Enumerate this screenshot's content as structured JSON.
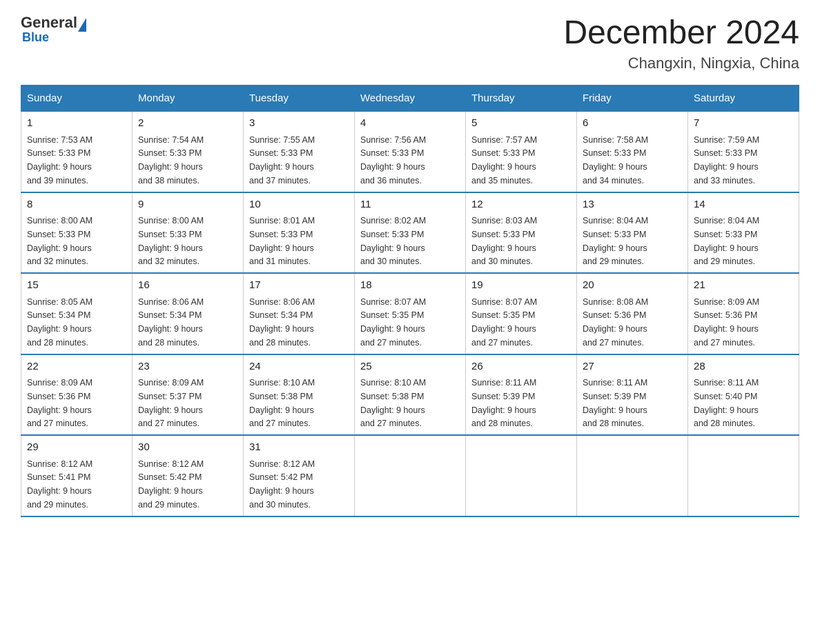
{
  "logo": {
    "general": "General",
    "blue": "Blue",
    "tagline": "Blue"
  },
  "header": {
    "title": "December 2024",
    "subtitle": "Changxin, Ningxia, China"
  },
  "weekdays": [
    "Sunday",
    "Monday",
    "Tuesday",
    "Wednesday",
    "Thursday",
    "Friday",
    "Saturday"
  ],
  "weeks": [
    [
      {
        "day": "1",
        "sunrise": "7:53 AM",
        "sunset": "5:33 PM",
        "daylight": "9 hours and 39 minutes."
      },
      {
        "day": "2",
        "sunrise": "7:54 AM",
        "sunset": "5:33 PM",
        "daylight": "9 hours and 38 minutes."
      },
      {
        "day": "3",
        "sunrise": "7:55 AM",
        "sunset": "5:33 PM",
        "daylight": "9 hours and 37 minutes."
      },
      {
        "day": "4",
        "sunrise": "7:56 AM",
        "sunset": "5:33 PM",
        "daylight": "9 hours and 36 minutes."
      },
      {
        "day": "5",
        "sunrise": "7:57 AM",
        "sunset": "5:33 PM",
        "daylight": "9 hours and 35 minutes."
      },
      {
        "day": "6",
        "sunrise": "7:58 AM",
        "sunset": "5:33 PM",
        "daylight": "9 hours and 34 minutes."
      },
      {
        "day": "7",
        "sunrise": "7:59 AM",
        "sunset": "5:33 PM",
        "daylight": "9 hours and 33 minutes."
      }
    ],
    [
      {
        "day": "8",
        "sunrise": "8:00 AM",
        "sunset": "5:33 PM",
        "daylight": "9 hours and 32 minutes."
      },
      {
        "day": "9",
        "sunrise": "8:00 AM",
        "sunset": "5:33 PM",
        "daylight": "9 hours and 32 minutes."
      },
      {
        "day": "10",
        "sunrise": "8:01 AM",
        "sunset": "5:33 PM",
        "daylight": "9 hours and 31 minutes."
      },
      {
        "day": "11",
        "sunrise": "8:02 AM",
        "sunset": "5:33 PM",
        "daylight": "9 hours and 30 minutes."
      },
      {
        "day": "12",
        "sunrise": "8:03 AM",
        "sunset": "5:33 PM",
        "daylight": "9 hours and 30 minutes."
      },
      {
        "day": "13",
        "sunrise": "8:04 AM",
        "sunset": "5:33 PM",
        "daylight": "9 hours and 29 minutes."
      },
      {
        "day": "14",
        "sunrise": "8:04 AM",
        "sunset": "5:33 PM",
        "daylight": "9 hours and 29 minutes."
      }
    ],
    [
      {
        "day": "15",
        "sunrise": "8:05 AM",
        "sunset": "5:34 PM",
        "daylight": "9 hours and 28 minutes."
      },
      {
        "day": "16",
        "sunrise": "8:06 AM",
        "sunset": "5:34 PM",
        "daylight": "9 hours and 28 minutes."
      },
      {
        "day": "17",
        "sunrise": "8:06 AM",
        "sunset": "5:34 PM",
        "daylight": "9 hours and 28 minutes."
      },
      {
        "day": "18",
        "sunrise": "8:07 AM",
        "sunset": "5:35 PM",
        "daylight": "9 hours and 27 minutes."
      },
      {
        "day": "19",
        "sunrise": "8:07 AM",
        "sunset": "5:35 PM",
        "daylight": "9 hours and 27 minutes."
      },
      {
        "day": "20",
        "sunrise": "8:08 AM",
        "sunset": "5:36 PM",
        "daylight": "9 hours and 27 minutes."
      },
      {
        "day": "21",
        "sunrise": "8:09 AM",
        "sunset": "5:36 PM",
        "daylight": "9 hours and 27 minutes."
      }
    ],
    [
      {
        "day": "22",
        "sunrise": "8:09 AM",
        "sunset": "5:36 PM",
        "daylight": "9 hours and 27 minutes."
      },
      {
        "day": "23",
        "sunrise": "8:09 AM",
        "sunset": "5:37 PM",
        "daylight": "9 hours and 27 minutes."
      },
      {
        "day": "24",
        "sunrise": "8:10 AM",
        "sunset": "5:38 PM",
        "daylight": "9 hours and 27 minutes."
      },
      {
        "day": "25",
        "sunrise": "8:10 AM",
        "sunset": "5:38 PM",
        "daylight": "9 hours and 27 minutes."
      },
      {
        "day": "26",
        "sunrise": "8:11 AM",
        "sunset": "5:39 PM",
        "daylight": "9 hours and 28 minutes."
      },
      {
        "day": "27",
        "sunrise": "8:11 AM",
        "sunset": "5:39 PM",
        "daylight": "9 hours and 28 minutes."
      },
      {
        "day": "28",
        "sunrise": "8:11 AM",
        "sunset": "5:40 PM",
        "daylight": "9 hours and 28 minutes."
      }
    ],
    [
      {
        "day": "29",
        "sunrise": "8:12 AM",
        "sunset": "5:41 PM",
        "daylight": "9 hours and 29 minutes."
      },
      {
        "day": "30",
        "sunrise": "8:12 AM",
        "sunset": "5:42 PM",
        "daylight": "9 hours and 29 minutes."
      },
      {
        "day": "31",
        "sunrise": "8:12 AM",
        "sunset": "5:42 PM",
        "daylight": "9 hours and 30 minutes."
      },
      null,
      null,
      null,
      null
    ]
  ],
  "labels": {
    "sunrise": "Sunrise:",
    "sunset": "Sunset:",
    "daylight": "Daylight:"
  }
}
